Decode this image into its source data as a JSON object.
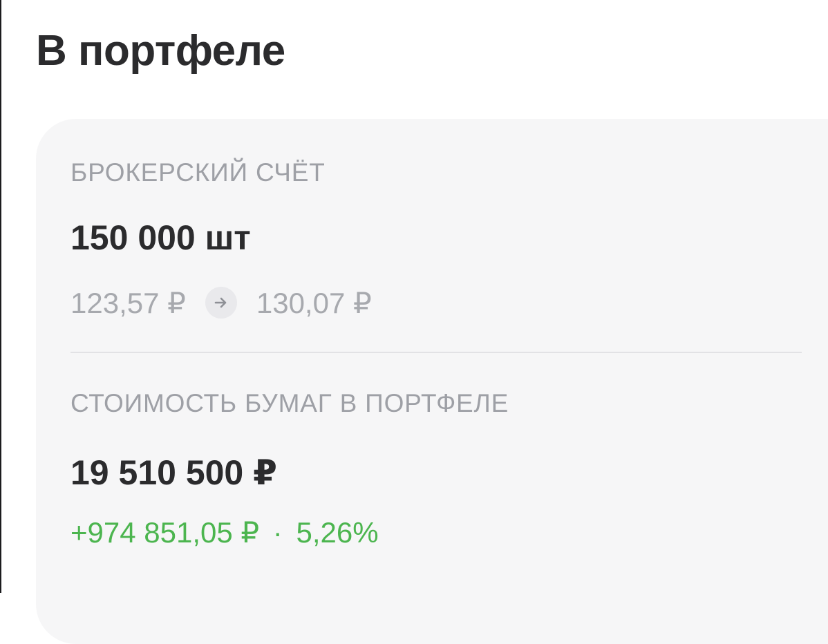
{
  "header": {
    "title": "В портфеле"
  },
  "broker_section": {
    "label": "БРОКЕРСКИЙ СЧЁТ",
    "quantity": "150 000 шт",
    "price_from": "123,57 ₽",
    "price_to": "130,07 ₽",
    "arrow_icon": "arrow-right-icon"
  },
  "value_section": {
    "label": "СТОИМОСТЬ БУМАГ В ПОРТФЕЛЕ",
    "total_value": "19 510 500 ₽",
    "change_amount": "+974 851,05 ₽",
    "separator": "·",
    "change_percent": "5,26%"
  },
  "colors": {
    "title_text": "#2b2b2d",
    "card_background": "#f6f6f7",
    "label_text": "#9ea0a6",
    "muted_price": "#a7a9ae",
    "positive_green": "#4cb54f",
    "divider": "#e2e2e5"
  }
}
